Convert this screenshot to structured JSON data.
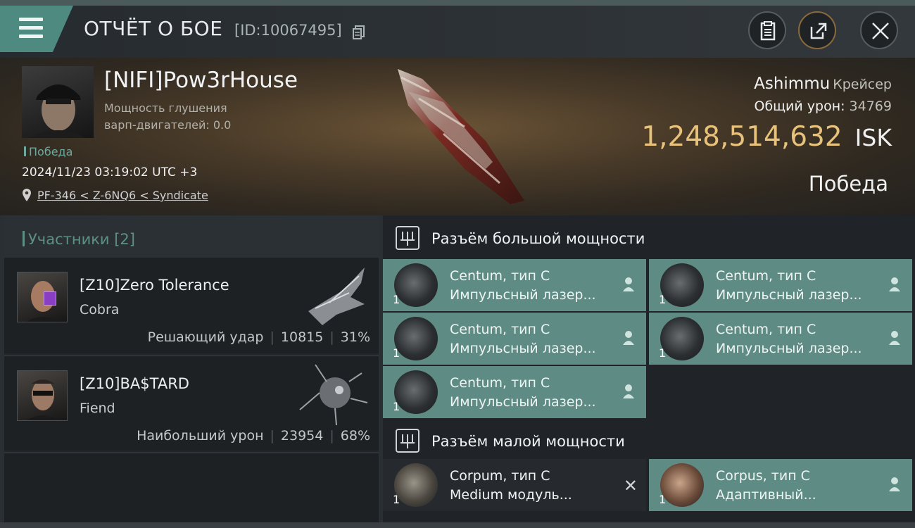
{
  "header": {
    "title": "ОТЧЁТ О БОЕ",
    "report_id": "[ID:10067495]",
    "menu_icon": "hamburger-icon",
    "copy_icon": "copy-icon",
    "actions": [
      {
        "icon": "clipboard-icon"
      },
      {
        "icon": "share-icon"
      },
      {
        "icon": "close-icon"
      }
    ]
  },
  "victim": {
    "name": "[NIFI]Pow3rHouse",
    "stat_line1": "Мощность глушения",
    "stat_line2": "варп-двигателей: 0.0",
    "result": "Победа",
    "datetime": "2024/11/23 03:19:02 UTC +3",
    "location": "PF-346 < Z-6NQ6 < Syndicate",
    "ship_name": "Ashimmu",
    "ship_class": "Крейсер",
    "total_damage_label": "Общий урон:",
    "total_damage_value": "34769",
    "isk_value": "1,248,514,632",
    "isk_unit": "ISK",
    "outcome": "Победа"
  },
  "participants": {
    "title": "Участники [2]",
    "items": [
      {
        "name": "[Z10]Zero Tolerance",
        "ship": "Cobra",
        "role": "Решающий удар",
        "damage": "10815",
        "percent": "31%"
      },
      {
        "name": "[Z10]BA$TARD",
        "ship": "Fiend",
        "role": "Наибольший урон",
        "damage": "23954",
        "percent": "68%"
      }
    ]
  },
  "fitting": {
    "high_title": "Разъём большой мощности",
    "low_title": "Разъём малой мощности",
    "high_slots": [
      {
        "qty": "1",
        "name": "Centum, тип С",
        "type": "Импульсный лазер..."
      },
      {
        "qty": "1",
        "name": "Centum, тип С",
        "type": "Импульсный лазер..."
      },
      {
        "qty": "1",
        "name": "Centum, тип С",
        "type": "Импульсный лазер..."
      },
      {
        "qty": "1",
        "name": "Centum, тип С",
        "type": "Импульсный лазер..."
      },
      {
        "qty": "1",
        "name": "Centum, тип С",
        "type": "Импульсный лазер..."
      }
    ],
    "low_slots": [
      {
        "qty": "1",
        "name": "Corpum, тип С",
        "type": "Medium модуль..."
      },
      {
        "qty": "1",
        "name": "Corpus, тип С",
        "type": "Адаптивный..."
      }
    ]
  },
  "colors": {
    "accent_teal": "#5e8b84",
    "isk_gold": "#e8c27a",
    "result_green": "#6ea89d"
  }
}
